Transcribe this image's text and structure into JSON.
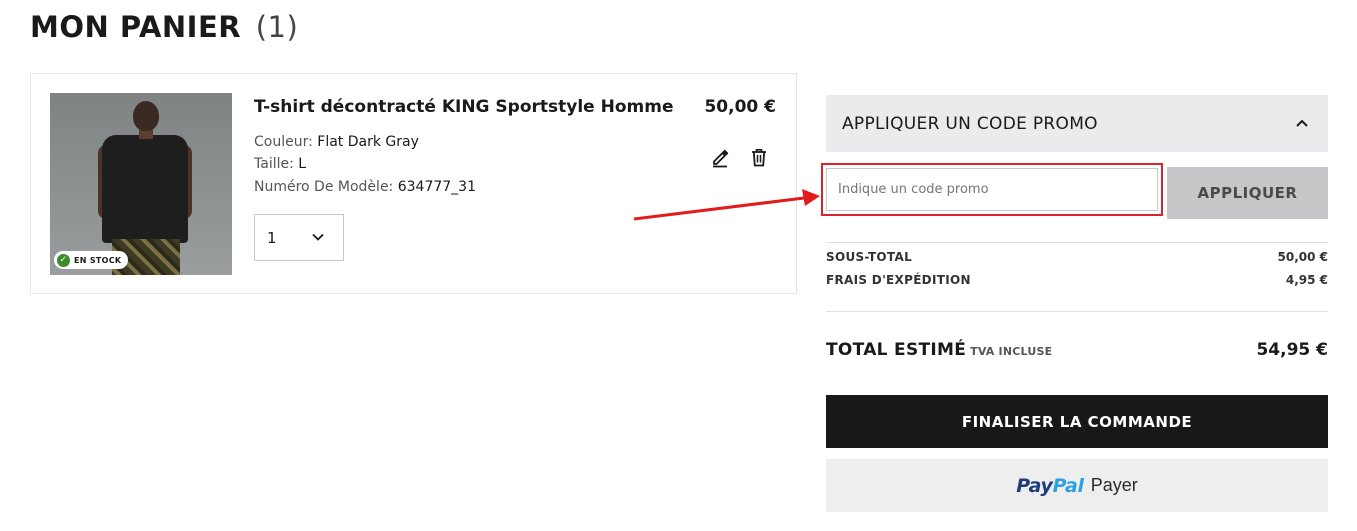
{
  "page": {
    "title": "MON PANIER",
    "count": "(1)"
  },
  "product": {
    "name": "T-shirt décontracté KING Sportstyle Homme",
    "price": "50,00 €",
    "stock_badge": "EN STOCK",
    "color_label": "Couleur: ",
    "color_value": "Flat Dark Gray",
    "size_label": "Taille: ",
    "size_value": "L",
    "model_label": "Numéro De Modèle: ",
    "model_value": "634777_31",
    "quantity": "1",
    "icons": {
      "edit": "pencil-icon",
      "delete": "trash-icon",
      "stock": "check-circle-icon",
      "quantity": "chevron-down-icon"
    }
  },
  "promo": {
    "header": "APPLIQUER UN CODE PROMO",
    "placeholder": "Indique un code promo",
    "apply_label": "APPLIQUER",
    "highlight_color": "#d9232e"
  },
  "summary": {
    "subtotal_label": "SOUS-TOTAL",
    "subtotal_value": "50,00 €",
    "shipping_label": "FRAIS D'EXPÉDITION",
    "shipping_value": "4,95 €",
    "total_label": "TOTAL ESTIMÉ",
    "tva_label": "TVA INCLUSE",
    "total_value": "54,95 €"
  },
  "actions": {
    "checkout_label": "FINALISER LA COMMANDE",
    "paypal_pay": "Pay",
    "paypal_pal": "Pal",
    "paypal_label": "Payer"
  }
}
